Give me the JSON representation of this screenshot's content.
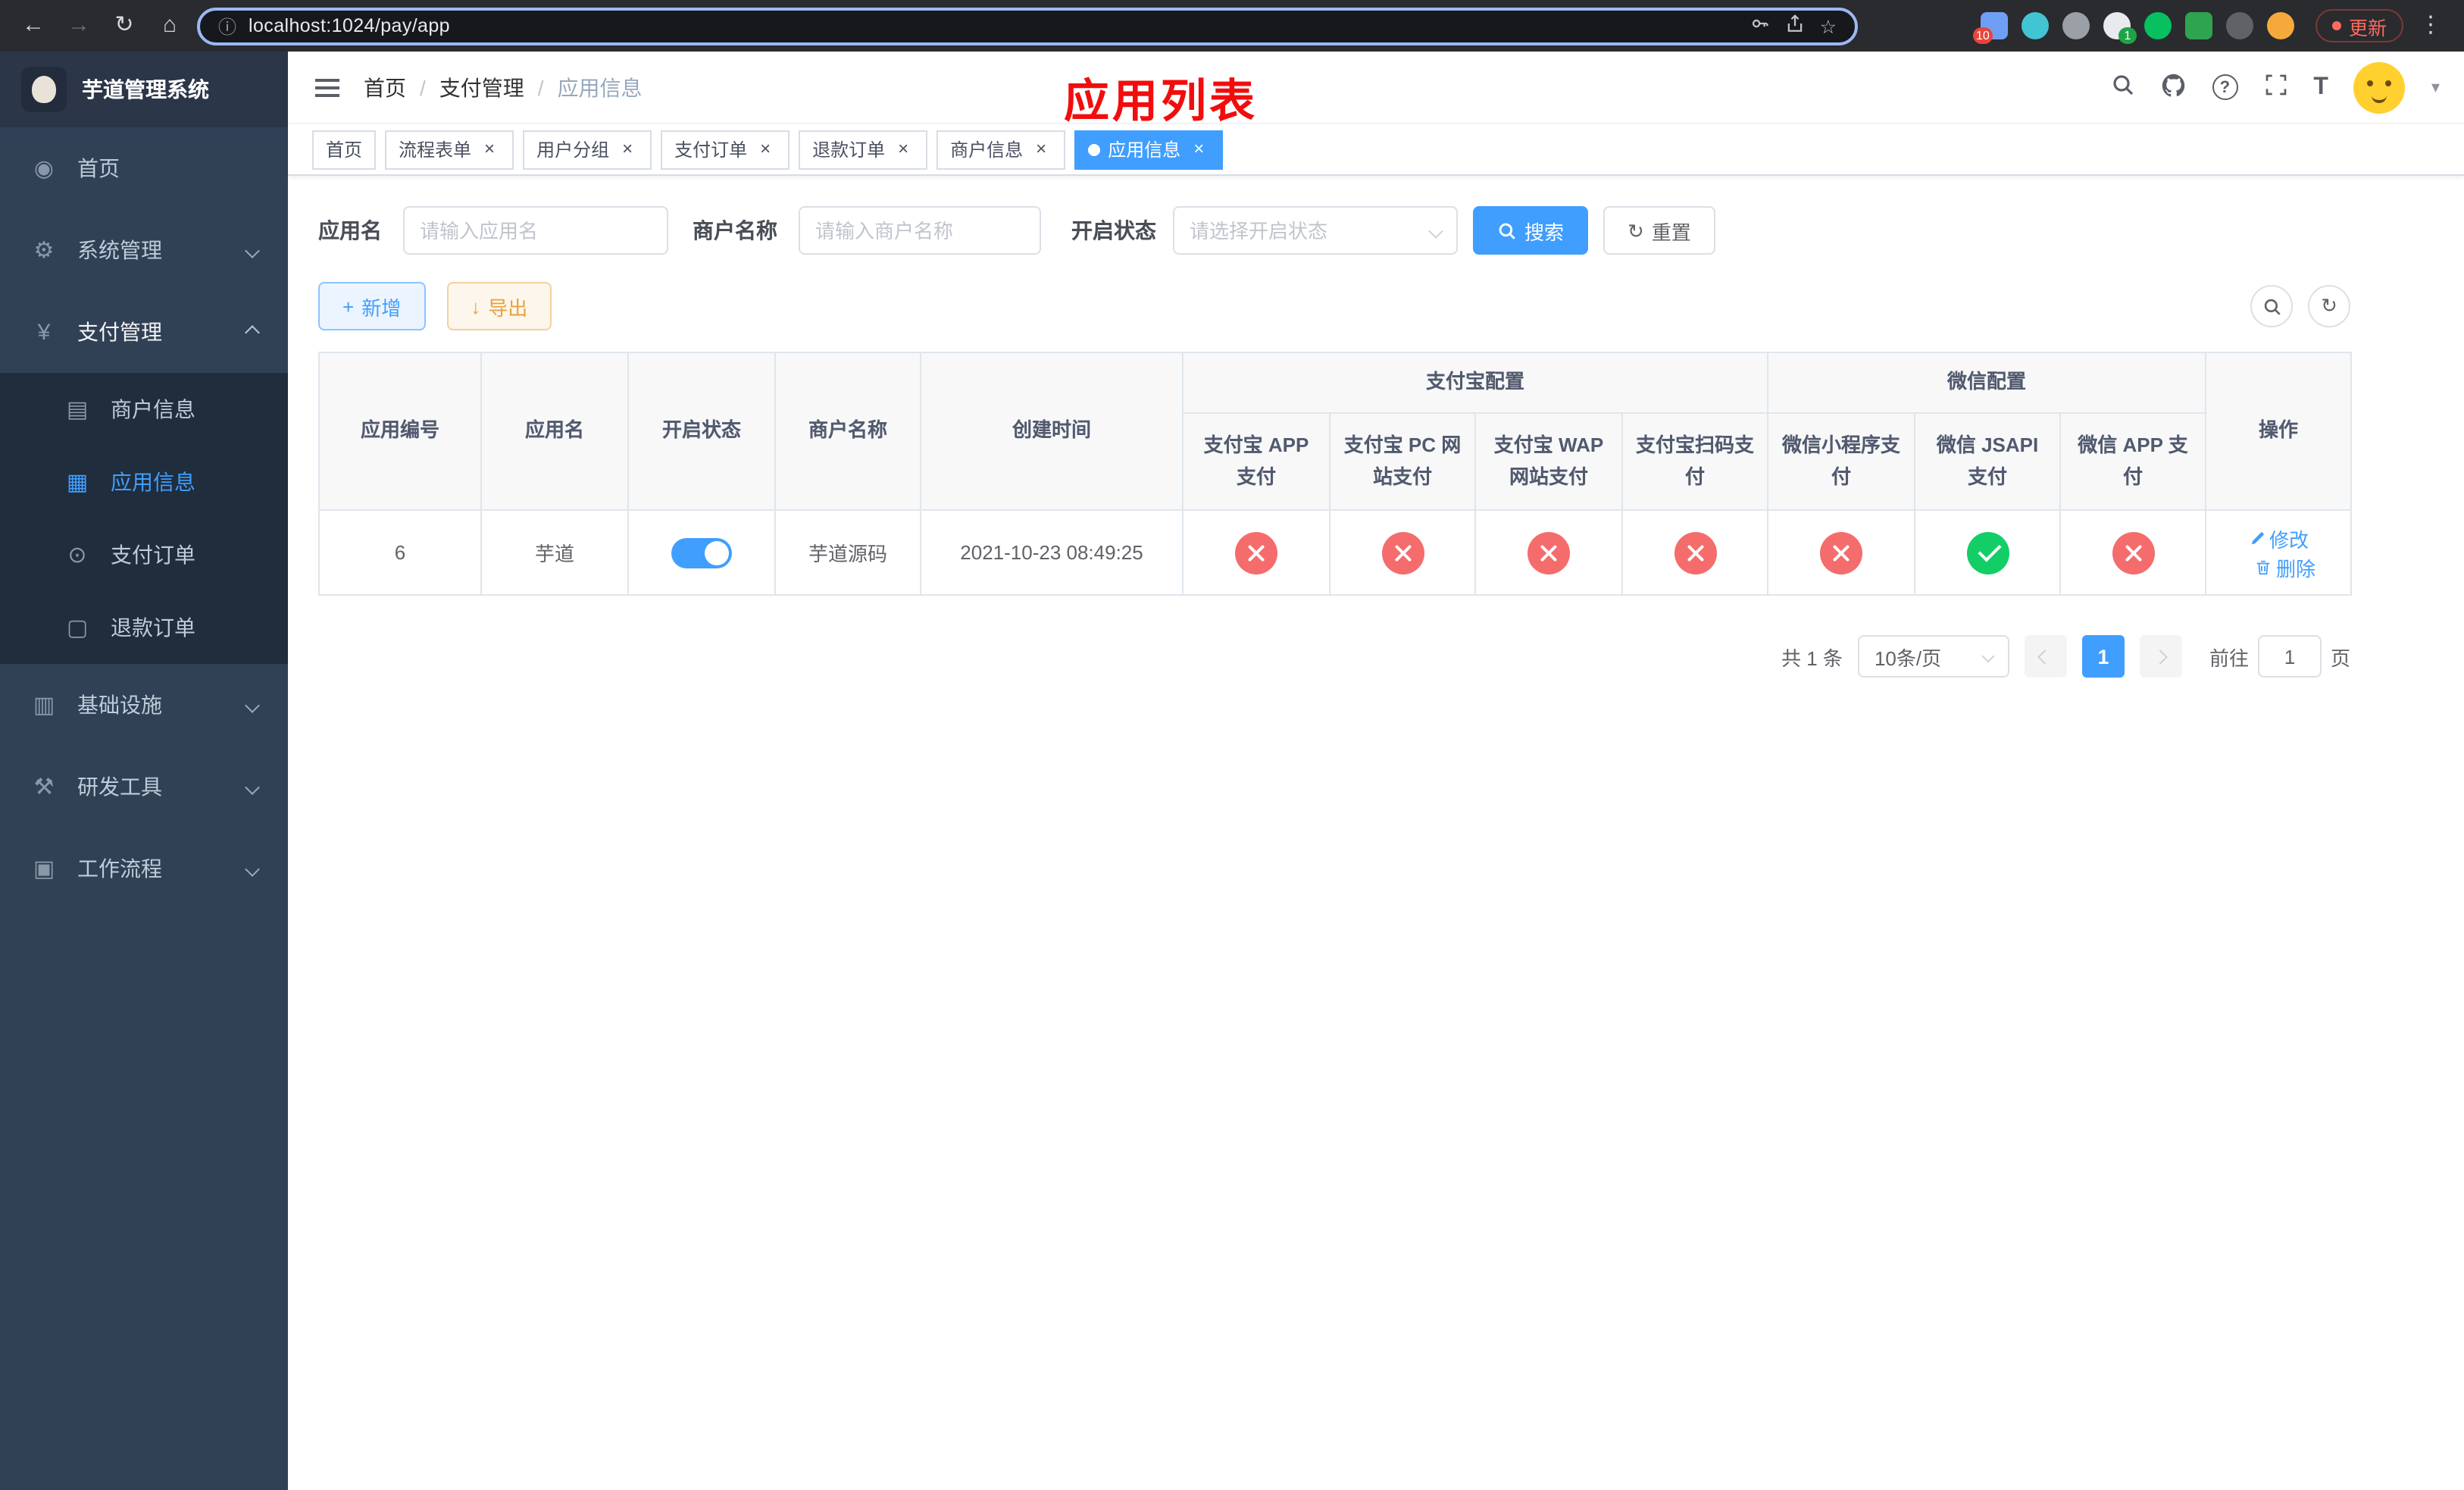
{
  "colors": {
    "accent": "#409eff",
    "success": "#13ce66",
    "danger": "#f56c6c",
    "warning": "#e6a23c",
    "sidebar_bg": "#304156",
    "submenu_bg": "#1f2d3d",
    "title_red": "#f20d0d"
  },
  "icons": {
    "back": "←",
    "forward": "→",
    "reload": "↻",
    "home": "⌂",
    "info": "ⓘ",
    "star": "☆",
    "menu": "⋮",
    "caret": "▾",
    "close": "×",
    "plus": "+",
    "download": "↓",
    "refresh": "↻",
    "question": "?",
    "fontsize": "T",
    "dashboard": "◉",
    "gear": "⚙",
    "yen": "¥",
    "card": "▤",
    "grid": "▦",
    "order": "⊙",
    "doc": "▢",
    "infra": "▥",
    "tools": "⚒",
    "workflow": "▣"
  },
  "browser": {
    "url": "localhost:1024/pay/app",
    "update_label": "更新",
    "extension_badge_1": "10",
    "extension_badge_2": "1"
  },
  "sidebar": {
    "logo_title": "芋道管理系统",
    "items": [
      {
        "label": "首页"
      },
      {
        "label": "系统管理"
      },
      {
        "label": "支付管理",
        "children": [
          {
            "label": "商户信息"
          },
          {
            "label": "应用信息"
          },
          {
            "label": "支付订单"
          },
          {
            "label": "退款订单"
          }
        ]
      },
      {
        "label": "基础设施"
      },
      {
        "label": "研发工具"
      },
      {
        "label": "工作流程"
      }
    ]
  },
  "header": {
    "breadcrumb": [
      "首页",
      "支付管理",
      "应用信息"
    ],
    "separator": "/",
    "page_title": "应用列表"
  },
  "tabs": [
    {
      "label": "首页"
    },
    {
      "label": "流程表单"
    },
    {
      "label": "用户分组"
    },
    {
      "label": "支付订单"
    },
    {
      "label": "退款订单"
    },
    {
      "label": "商户信息"
    },
    {
      "label": "应用信息"
    }
  ],
  "filters": {
    "app_name_label": "应用名",
    "app_name_placeholder": "请输入应用名",
    "merchant_label": "商户名称",
    "merchant_placeholder": "请输入商户名称",
    "status_label": "开启状态",
    "status_placeholder": "请选择开启状态",
    "search_label": "搜索",
    "reset_label": "重置"
  },
  "toolbar": {
    "add_label": "新增",
    "export_label": "导出"
  },
  "table": {
    "col_app_id": "应用编号",
    "col_app_name": "应用名",
    "col_status": "开启状态",
    "col_merchant": "商户名称",
    "col_create_time": "创建时间",
    "group_alipay": "支付宝配置",
    "group_wechat": "微信配置",
    "col_alipay_app": "支付宝 APP 支付",
    "col_alipay_pc": "支付宝 PC 网站支付",
    "col_alipay_wap": "支付宝 WAP 网站支付",
    "col_alipay_qr": "支付宝扫码支付",
    "col_wechat_mini": "微信小程序支付",
    "col_wechat_jsapi": "微信 JSAPI 支付",
    "col_wechat_app": "微信 APP 支付",
    "col_actions": "操作",
    "rows": [
      {
        "app_id": "6",
        "app_name": "芋道",
        "status_on": true,
        "merchant": "芋道源码",
        "create_time": "2021-10-23 08:49:25",
        "configs": [
          "no",
          "no",
          "no",
          "no",
          "no",
          "yes",
          "no"
        ],
        "edit_label": "修改",
        "delete_label": "删除"
      }
    ]
  },
  "pagination": {
    "total": "共 1 条",
    "page_size": "10条/页",
    "current_page": "1",
    "goto_label": "前往",
    "goto_value": "1",
    "page_unit": "页"
  }
}
